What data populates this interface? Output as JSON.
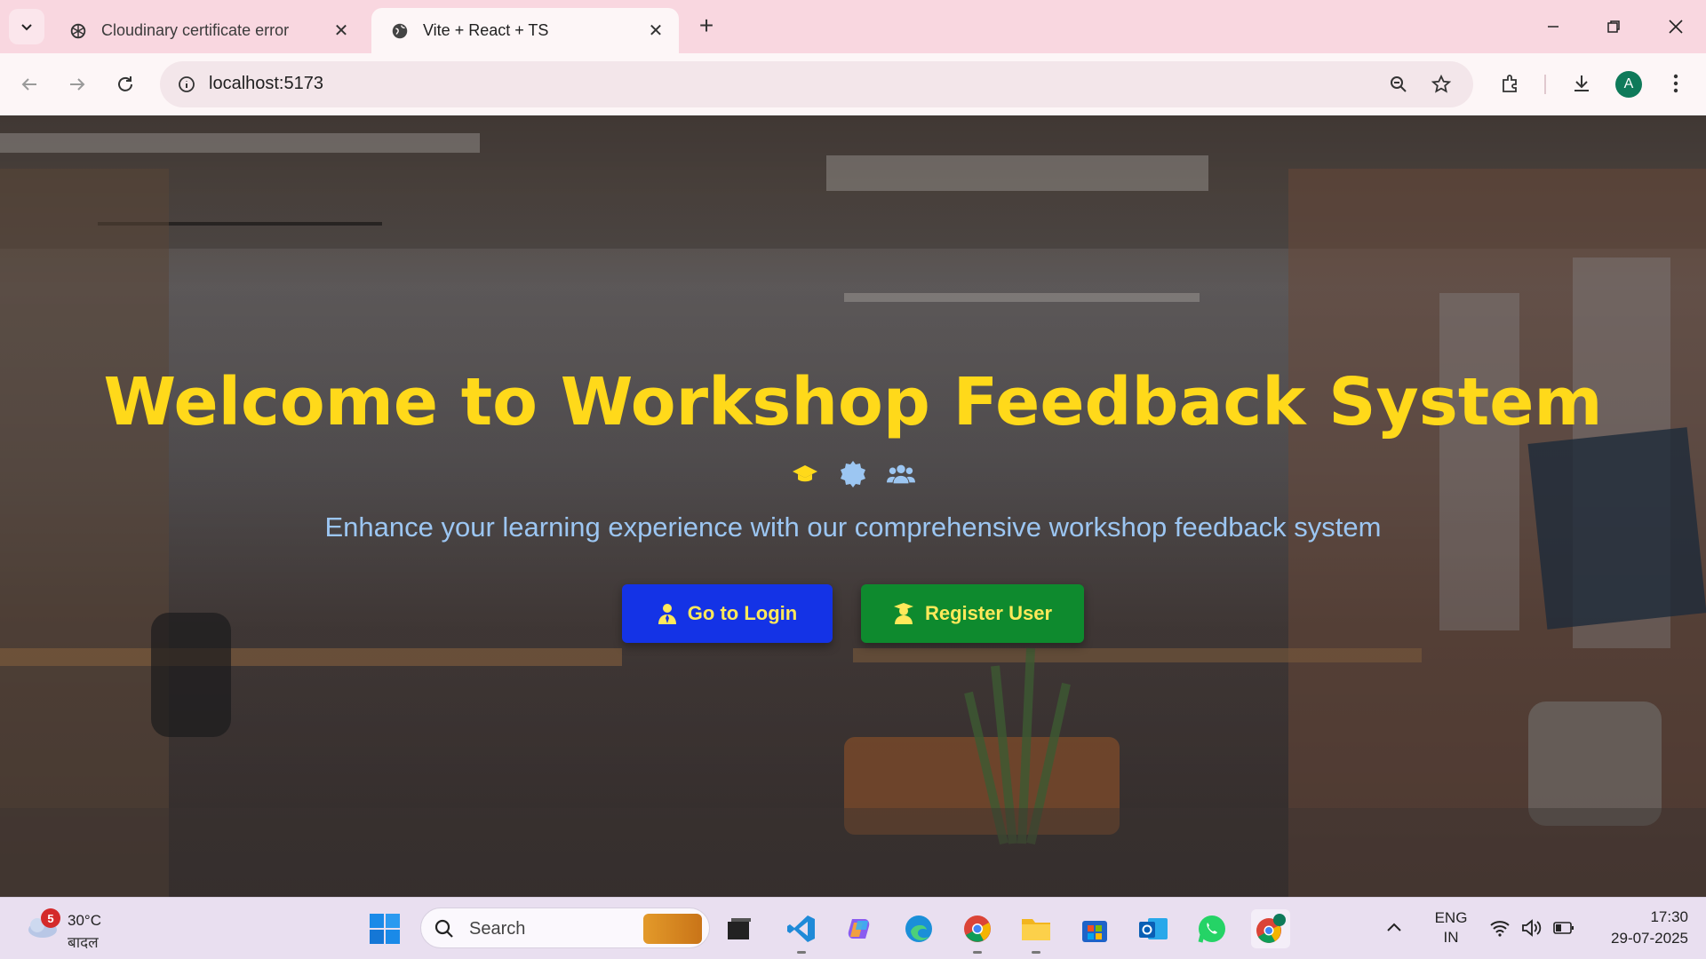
{
  "browser": {
    "tabs": [
      {
        "title": "Cloudinary certificate error",
        "favicon": "openai-icon",
        "active": false
      },
      {
        "title": "Vite + React + TS",
        "favicon": "globe-icon",
        "active": true
      }
    ],
    "url": "localhost:5173",
    "profile_initial": "A"
  },
  "hero": {
    "title": "Welcome to Workshop Feedback System",
    "icons": [
      "graduation-cap-icon",
      "certificate-icon",
      "users-icon"
    ],
    "subtitle": "Enhance your learning experience with our comprehensive workshop feedback system",
    "buttons": {
      "login_label": "Go to Login",
      "register_label": "Register User"
    }
  },
  "taskbar": {
    "weather": {
      "badge": "5",
      "temp": "30°C",
      "condition": "बादल"
    },
    "search_label": "Search",
    "language": {
      "line1": "ENG",
      "line2": "IN"
    },
    "clock": {
      "time": "17:30",
      "date": "29-07-2025"
    }
  },
  "colors": {
    "title": "#ffd91a",
    "subtitle": "#9cc6f2",
    "login_button": "#1433e6",
    "register_button": "#0e8a2e",
    "button_text": "#ffe95a"
  }
}
